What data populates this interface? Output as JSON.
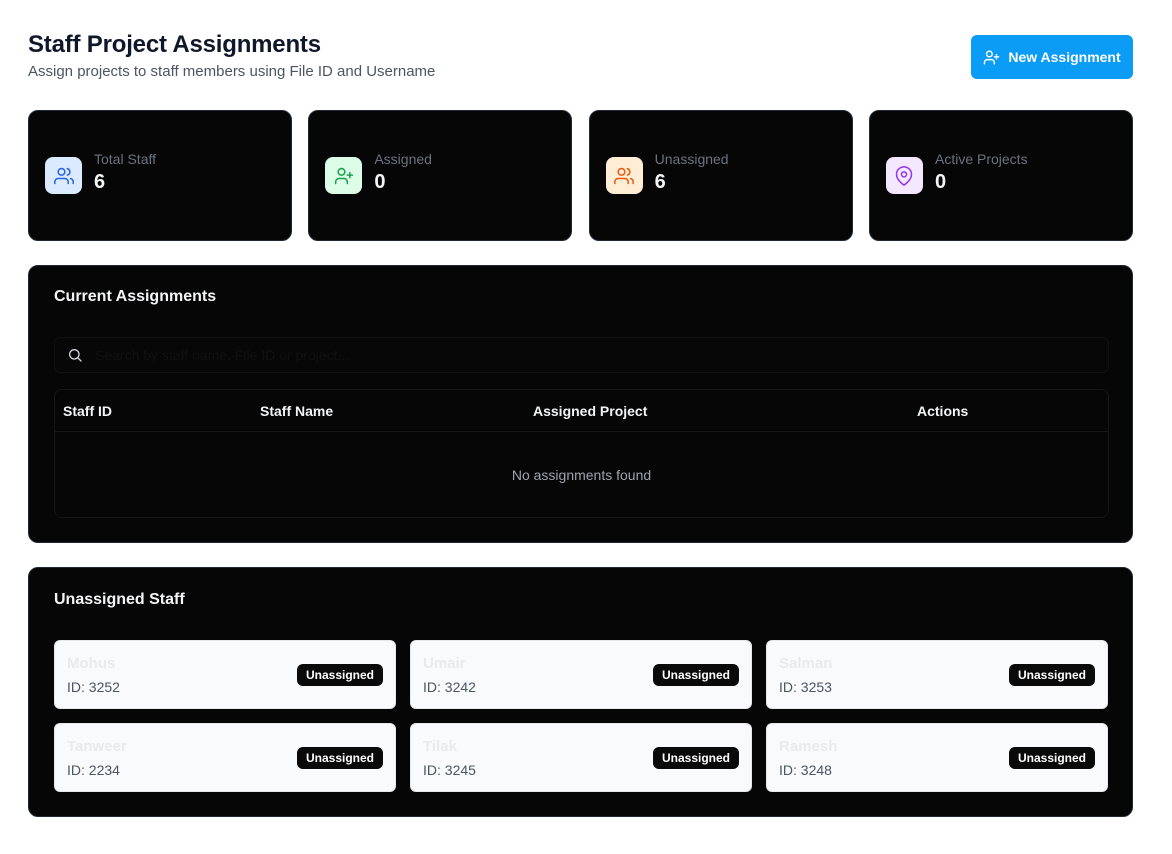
{
  "header": {
    "title": "Staff Project Assignments",
    "subtitle": "Assign projects to staff members using File ID and Username",
    "new_button_label": "New Assignment"
  },
  "stats": [
    {
      "label": "Total Staff",
      "value": "6",
      "icon": "users-icon",
      "icon_bg": "#dbeafe",
      "icon_color": "#2563eb"
    },
    {
      "label": "Assigned",
      "value": "0",
      "icon": "user-plus-icon",
      "icon_bg": "#dcfce7",
      "icon_color": "#16a34a"
    },
    {
      "label": "Unassigned",
      "value": "6",
      "icon": "users-icon",
      "icon_bg": "#ffedd5",
      "icon_color": "#ea580c"
    },
    {
      "label": "Active Projects",
      "value": "0",
      "icon": "map-pin-icon",
      "icon_bg": "#f3e8ff",
      "icon_color": "#9333ea"
    }
  ],
  "assignments": {
    "title": "Current Assignments",
    "search_placeholder": "Search by staff name, File ID or project...",
    "columns": [
      "Staff ID",
      "Staff Name",
      "Assigned Project",
      "Actions"
    ],
    "empty_text": "No assignments found"
  },
  "unassigned": {
    "title": "Unassigned Staff",
    "staff": [
      {
        "name": "Mohus",
        "id": "ID: 3252",
        "badge": "Unassigned"
      },
      {
        "name": "Umair",
        "id": "ID: 3242",
        "badge": "Unassigned"
      },
      {
        "name": "Salman",
        "id": "ID: 3253",
        "badge": "Unassigned"
      },
      {
        "name": "Tanweer",
        "id": "ID: 2234",
        "badge": "Unassigned"
      },
      {
        "name": "Tilak",
        "id": "ID: 3245",
        "badge": "Unassigned"
      },
      {
        "name": "Ramesh",
        "id": "ID: 3248",
        "badge": "Unassigned"
      }
    ]
  },
  "colors": {
    "accent": "#0b9cf6",
    "panel_bg": "#060606"
  }
}
